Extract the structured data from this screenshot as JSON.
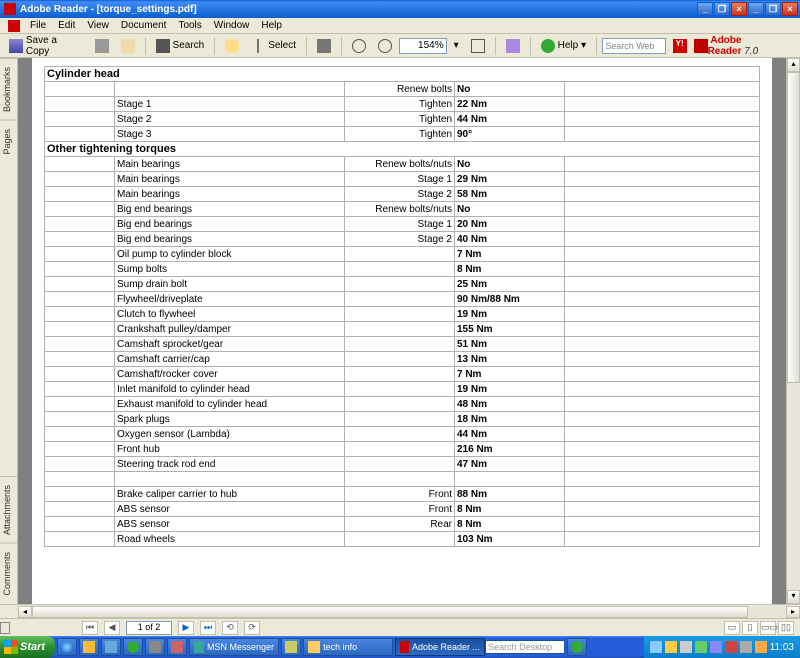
{
  "window": {
    "title": "Adobe Reader - [torque_settings.pdf]"
  },
  "menu": [
    "File",
    "Edit",
    "View",
    "Document",
    "Tools",
    "Window",
    "Help"
  ],
  "toolbar": {
    "save": "Save a Copy",
    "search": "Search",
    "select": "Select",
    "zoom": "154%",
    "help": "Help",
    "searchweb": "Search Web",
    "brand": "Adobe Reader",
    "version": "7.0"
  },
  "sidetabs": [
    "Bookmarks",
    "Pages",
    "Attachments",
    "Comments"
  ],
  "nav": {
    "page": "1 of 2"
  },
  "doc": {
    "sections": [
      {
        "heading": "Cylinder head",
        "rows": [
          {
            "label": "",
            "sub": "Renew bolts",
            "val": "No"
          },
          {
            "label": "Stage 1",
            "sub": "Tighten",
            "val": "22 Nm"
          },
          {
            "label": "Stage 2",
            "sub": "Tighten",
            "val": "44 Nm"
          },
          {
            "label": "Stage 3",
            "sub": "Tighten",
            "val": "90°"
          }
        ]
      },
      {
        "heading": "Other tightening torques",
        "rows": [
          {
            "label": "Main bearings",
            "sub": "Renew bolts/nuts",
            "val": "No"
          },
          {
            "label": "Main bearings",
            "sub": "Stage 1",
            "val": "29 Nm"
          },
          {
            "label": "Main bearings",
            "sub": "Stage 2",
            "val": "58 Nm"
          },
          {
            "label": "Big end bearings",
            "sub": "Renew bolts/nuts",
            "val": "No"
          },
          {
            "label": "Big end bearings",
            "sub": "Stage 1",
            "val": "20 Nm"
          },
          {
            "label": "Big end bearings",
            "sub": "Stage 2",
            "val": "40 Nm"
          },
          {
            "label": "Oil pump to cylinder block",
            "sub": "",
            "val": "7 Nm"
          },
          {
            "label": "Sump bolts",
            "sub": "",
            "val": "8 Nm"
          },
          {
            "label": "Sump drain bolt",
            "sub": "",
            "val": "25 Nm"
          },
          {
            "label": "Flywheel/driveplate",
            "sub": "",
            "val": "90 Nm/88 Nm"
          },
          {
            "label": "Clutch to flywheel",
            "sub": "",
            "val": "19 Nm"
          },
          {
            "label": "Crankshaft pulley/damper",
            "sub": "",
            "val": "155 Nm"
          },
          {
            "label": "Camshaft sprocket/gear",
            "sub": "",
            "val": "51 Nm"
          },
          {
            "label": "Camshaft carrier/cap",
            "sub": "",
            "val": "13 Nm"
          },
          {
            "label": "Camshaft/rocker cover",
            "sub": "",
            "val": "7 Nm"
          },
          {
            "label": "Inlet manifold to cylinder head",
            "sub": "",
            "val": "19 Nm"
          },
          {
            "label": "Exhaust manifold to cylinder head",
            "sub": "",
            "val": "48 Nm"
          },
          {
            "label": "Spark plugs",
            "sub": "",
            "val": "18 Nm"
          },
          {
            "label": "Oxygen sensor (Lambda)",
            "sub": "",
            "val": "44 Nm"
          },
          {
            "label": "Front hub",
            "sub": "",
            "val": "216 Nm"
          },
          {
            "label": "Steering track rod end",
            "sub": "",
            "val": "47 Nm"
          },
          {
            "label": "",
            "sub": "",
            "val": ""
          },
          {
            "label": "Brake caliper carrier to hub",
            "sub": "Front",
            "val": "88 Nm"
          },
          {
            "label": "ABS sensor",
            "sub": "Front",
            "val": "8 Nm"
          },
          {
            "label": "ABS sensor",
            "sub": "Rear",
            "val": "8 Nm"
          },
          {
            "label": "Road wheels",
            "sub": "",
            "val": "103 Nm"
          }
        ]
      }
    ]
  },
  "taskbar": {
    "start": "Start",
    "items": [
      "MSN Messenger",
      "tech info",
      "Adobe Reader ..."
    ],
    "searchdesktop": "Search Desktop",
    "time": "11:03"
  }
}
